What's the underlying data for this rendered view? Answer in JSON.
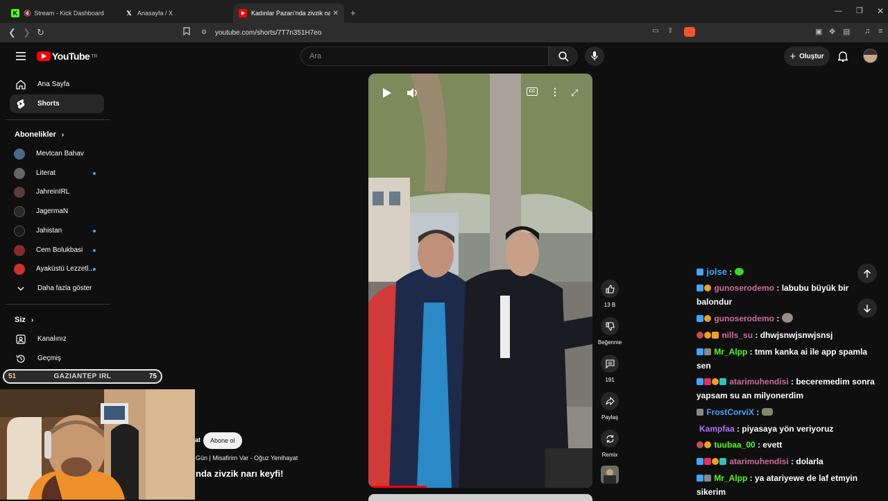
{
  "browser": {
    "tabs": [
      {
        "label": "Stream - Kick Dashboard",
        "icon": "kick-icon"
      },
      {
        "label": "Anasayfa / X",
        "icon": "x-icon"
      },
      {
        "label": "Kadınlar Pazarı'nda zivzik narı ke",
        "icon": "youtube-icon"
      }
    ],
    "url": "youtube.com/shorts/7T7n351H7eo"
  },
  "youtube": {
    "logo_text": "YouTube",
    "logo_sup": "TR",
    "search_placeholder": "Ara",
    "create_label": "Oluştur"
  },
  "sidebar": {
    "home": "Ana Sayfa",
    "shorts": "Shorts",
    "subs_head": "Abonelikler",
    "subs": [
      {
        "name": "Mevtcan Bahav",
        "color": "#4b6a8a",
        "live": false
      },
      {
        "name": "Literat",
        "color": "#666666",
        "live": true
      },
      {
        "name": "JahreinIRL",
        "color": "#5a3a3a",
        "live": false
      },
      {
        "name": "JagermaN",
        "color": "#2a2a2a",
        "live": false
      },
      {
        "name": "Jahistan",
        "color": "#1a1a1a",
        "live": true
      },
      {
        "name": "Cem Bolukbasi",
        "color": "#8a2a2a",
        "live": true
      },
      {
        "name": "Ayaküstü Lezzetl...",
        "color": "#d03030",
        "live": true
      }
    ],
    "more": "Daha fazla göster",
    "you_head": "Siz",
    "channel": "Kanalınız",
    "history": "Geçmiş"
  },
  "video": {
    "actions": {
      "likes": "13 B",
      "dislike": "Beğenme",
      "comments": "191",
      "share": "Paylaş",
      "remix": "Remix"
    },
    "channel_suffix": "at",
    "subscribe": "Abone ol",
    "subtitle": "Gün | Misafirim Var - Oğuz Yenihayat",
    "title": "nda zivzik narı keyfi!"
  },
  "stream_overlay": {
    "left_num": "51",
    "label": "GAZIANTEP IRL",
    "right_num": "75"
  },
  "chat": [
    {
      "user": "jolse",
      "color": "#3ea6ff",
      "text": "",
      "badges": [
        "#3ea6ff"
      ]
    },
    {
      "user": "gunoserodemo",
      "color": "#d06a9a",
      "text": "labubu büyük bir balondur",
      "badges": [
        "#3ea6ff",
        "#f0a020"
      ]
    },
    {
      "user": "gunoserodemo",
      "color": "#d06a9a",
      "text": "",
      "badges": [
        "#3ea6ff",
        "#f0a020"
      ]
    },
    {
      "user": "nills_su",
      "color": "#d06a9a",
      "text": "dhwjsnwjsnwjsnsj",
      "badges": [
        "#c05050",
        "#f0a020",
        "#f0a020"
      ]
    },
    {
      "user": "Mr_Alpp",
      "color": "#53fc18",
      "text": "tmm kanka ai ile app spamla sen",
      "badges": [
        "#3ea6ff",
        "#888888"
      ]
    },
    {
      "user": "atarimuhendisi",
      "color": "#d06a9a",
      "text": "beceremedim sonra yapsam su an milyonerdim",
      "badges": [
        "#3ea6ff",
        "#e03060",
        "#f0a020",
        "#30c0c0"
      ]
    },
    {
      "user": "FrostCorviX",
      "color": "#3ea6ff",
      "text": "",
      "badges": [
        "#888888"
      ]
    },
    {
      "user": "Kampfaa",
      "color": "#b070ff",
      "text": "piyasaya yön veriyoruz",
      "badges": []
    },
    {
      "user": "tuubaa_00",
      "color": "#53fc18",
      "text": "evett",
      "badges": [
        "#c05050",
        "#f0a020"
      ]
    },
    {
      "user": "atarimuhendisi",
      "color": "#d06a9a",
      "text": "dolarla",
      "badges": [
        "#3ea6ff",
        "#e03060",
        "#f0a020",
        "#30c0c0"
      ]
    },
    {
      "user": "Mr_Alpp",
      "color": "#53fc18",
      "text": "ya atariyewe de laf etmyin sikerim",
      "badges": [
        "#3ea6ff",
        "#888888"
      ]
    }
  ]
}
